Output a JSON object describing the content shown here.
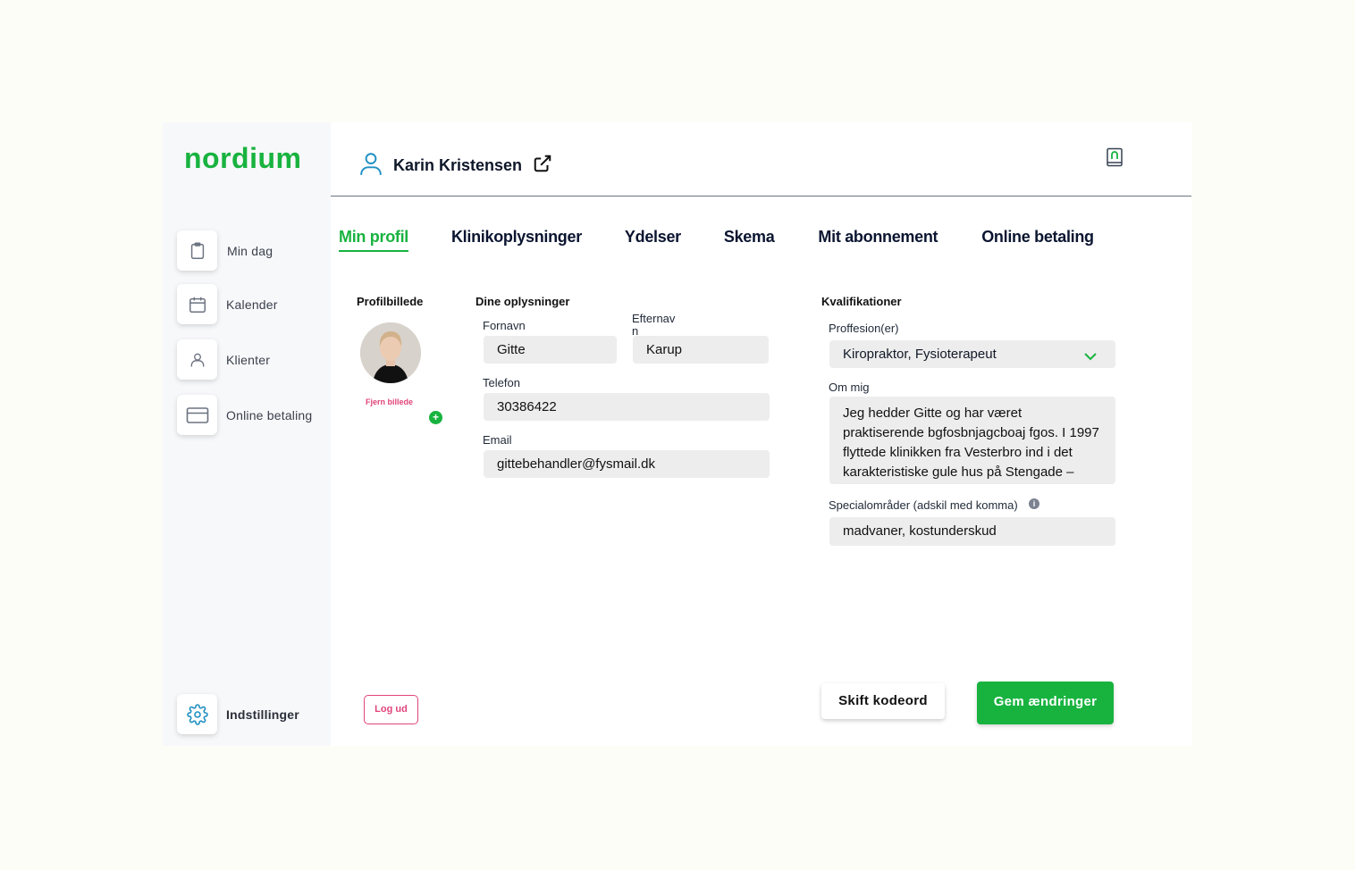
{
  "brand": {
    "logo": "nordium",
    "accent": "#18b33f",
    "danger": "#e0457b"
  },
  "sidebar": {
    "items": [
      {
        "label": "Min dag",
        "icon": "clipboard-icon"
      },
      {
        "label": "Kalender",
        "icon": "calendar-icon"
      },
      {
        "label": "Klienter",
        "icon": "user-icon"
      },
      {
        "label": "Online betaling",
        "icon": "credit-card-icon"
      }
    ],
    "settings": {
      "label": "Indstillinger",
      "icon": "gear-icon"
    }
  },
  "header": {
    "user_name": "Karin Kristensen",
    "external_icon": "external-link-icon",
    "book_icon": "book-icon"
  },
  "tabs": [
    "Min profil",
    "Klinikoplysninger",
    "Ydelser",
    "Skema",
    "Mit abonnement",
    "Online betaling"
  ],
  "profile_photo": {
    "title": "Profilbillede",
    "remove_label": "Fjern billede",
    "add_label": "+"
  },
  "info": {
    "title": "Dine oplysninger",
    "first_name": {
      "label": "Fornavn",
      "value": "Gitte"
    },
    "last_name": {
      "label": "Efternavn",
      "value": "Karup"
    },
    "phone": {
      "label": "Telefon",
      "value": "30386422"
    },
    "email": {
      "label": "Email",
      "value": "gittebehandler@fysmail.dk"
    }
  },
  "qualifications": {
    "title": "Kvalifikationer",
    "profession": {
      "label": "Proffesion(er)",
      "value": "Kiropraktor, Fysioterapeut"
    },
    "about": {
      "label": "Om mig",
      "value": "Jeg hedder Gitte og har været praktiserende bgfosbnjagcboaj fgos. I 1997 flyttede klinikken fra Vesterbro ind i det karakteristiske gule hus på Stengade –"
    },
    "specialties": {
      "label": "Specialområder (adskil med komma)",
      "value": "madvaner, kostunderskud",
      "info_icon": "i"
    }
  },
  "actions": {
    "logout": "Log ud",
    "change_password": "Skift kodeord",
    "save": "Gem ændringer"
  }
}
